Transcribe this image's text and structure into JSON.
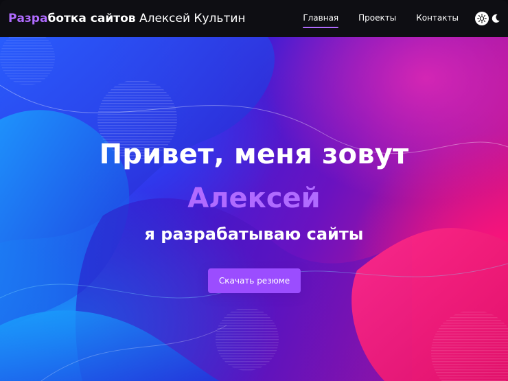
{
  "header": {
    "logo_accent": "Разра",
    "logo_bold": "ботка сайтов",
    "logo_rest": " Алексей Культин",
    "nav": [
      {
        "label": "Главная",
        "active": true
      },
      {
        "label": "Проекты",
        "active": false
      },
      {
        "label": "Контакты",
        "active": false
      }
    ],
    "theme_toggle": {
      "light_icon": "sun-icon",
      "dark_icon": "moon-icon"
    }
  },
  "hero": {
    "headline": "Привет, меня зовут",
    "name": "Алексей",
    "tagline": "я разрабатываю сайты",
    "cta_label": "Скачать резюме"
  },
  "colors": {
    "accent": "#b06bff",
    "button": "#9b4dff",
    "header_bg": "#0e0e13",
    "gradient_blue": "#1a3cf0",
    "gradient_pink": "#ff1a6a"
  }
}
